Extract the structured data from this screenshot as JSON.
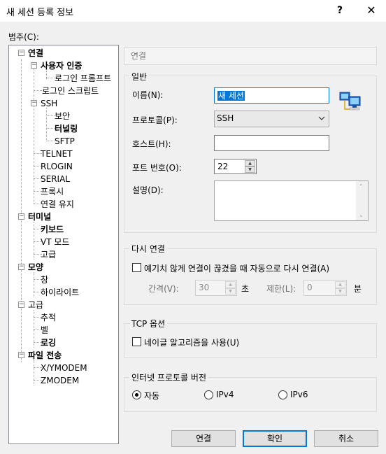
{
  "window": {
    "title": "새 세션 등록 정보",
    "help": "?",
    "close": "✕"
  },
  "category_label": "범주(C):",
  "tree": [
    {
      "label": "연결",
      "expanded": true
    },
    {
      "label": "사용자 인증",
      "expanded": true
    },
    {
      "label": "로그인 프롬프트"
    },
    {
      "label": "로그인 스크립트"
    },
    {
      "label": "SSH",
      "expanded": true
    },
    {
      "label": "보안"
    },
    {
      "label": "터널링"
    },
    {
      "label": "SFTP"
    },
    {
      "label": "TELNET"
    },
    {
      "label": "RLOGIN"
    },
    {
      "label": "SERIAL"
    },
    {
      "label": "프록시"
    },
    {
      "label": "연결 유지"
    },
    {
      "label": "터미널",
      "expanded": true
    },
    {
      "label": "키보드"
    },
    {
      "label": "VT 모드"
    },
    {
      "label": "고급"
    },
    {
      "label": "모양",
      "expanded": true
    },
    {
      "label": "창"
    },
    {
      "label": "하이라이트"
    },
    {
      "label": "고급",
      "expanded": true
    },
    {
      "label": "추적"
    },
    {
      "label": "벨"
    },
    {
      "label": "로깅"
    },
    {
      "label": "파일 전송",
      "expanded": true
    },
    {
      "label": "X/YMODEM"
    },
    {
      "label": "ZMODEM"
    }
  ],
  "page_header": "연결",
  "general": {
    "title": "일반",
    "name_label": "이름(N):",
    "name_value": "새 세션",
    "protocol_label": "프로토콜(P):",
    "protocol_value": "SSH",
    "host_label": "호스트(H):",
    "host_value": "",
    "port_label": "포트 번호(O):",
    "port_value": "22",
    "desc_label": "설명(D):",
    "desc_value": ""
  },
  "reconnect": {
    "title": "다시 연결",
    "auto_label": "예기치 않게 연결이 끊겼을 때 자동으로 다시 연결(A)",
    "interval_label": "간격(V):",
    "interval_value": "30",
    "interval_unit": "초",
    "limit_label": "제한(L):",
    "limit_value": "0",
    "limit_unit": "분"
  },
  "tcp": {
    "title": "TCP 옵션",
    "nagle_label": "네이글 알고리즘을 사용(U)"
  },
  "ipver": {
    "title": "인터넷 프로토콜 버전",
    "auto": "자동",
    "ipv4": "IPv4",
    "ipv6": "IPv6"
  },
  "buttons": {
    "connect": "연결",
    "ok": "확인",
    "cancel": "취소"
  }
}
